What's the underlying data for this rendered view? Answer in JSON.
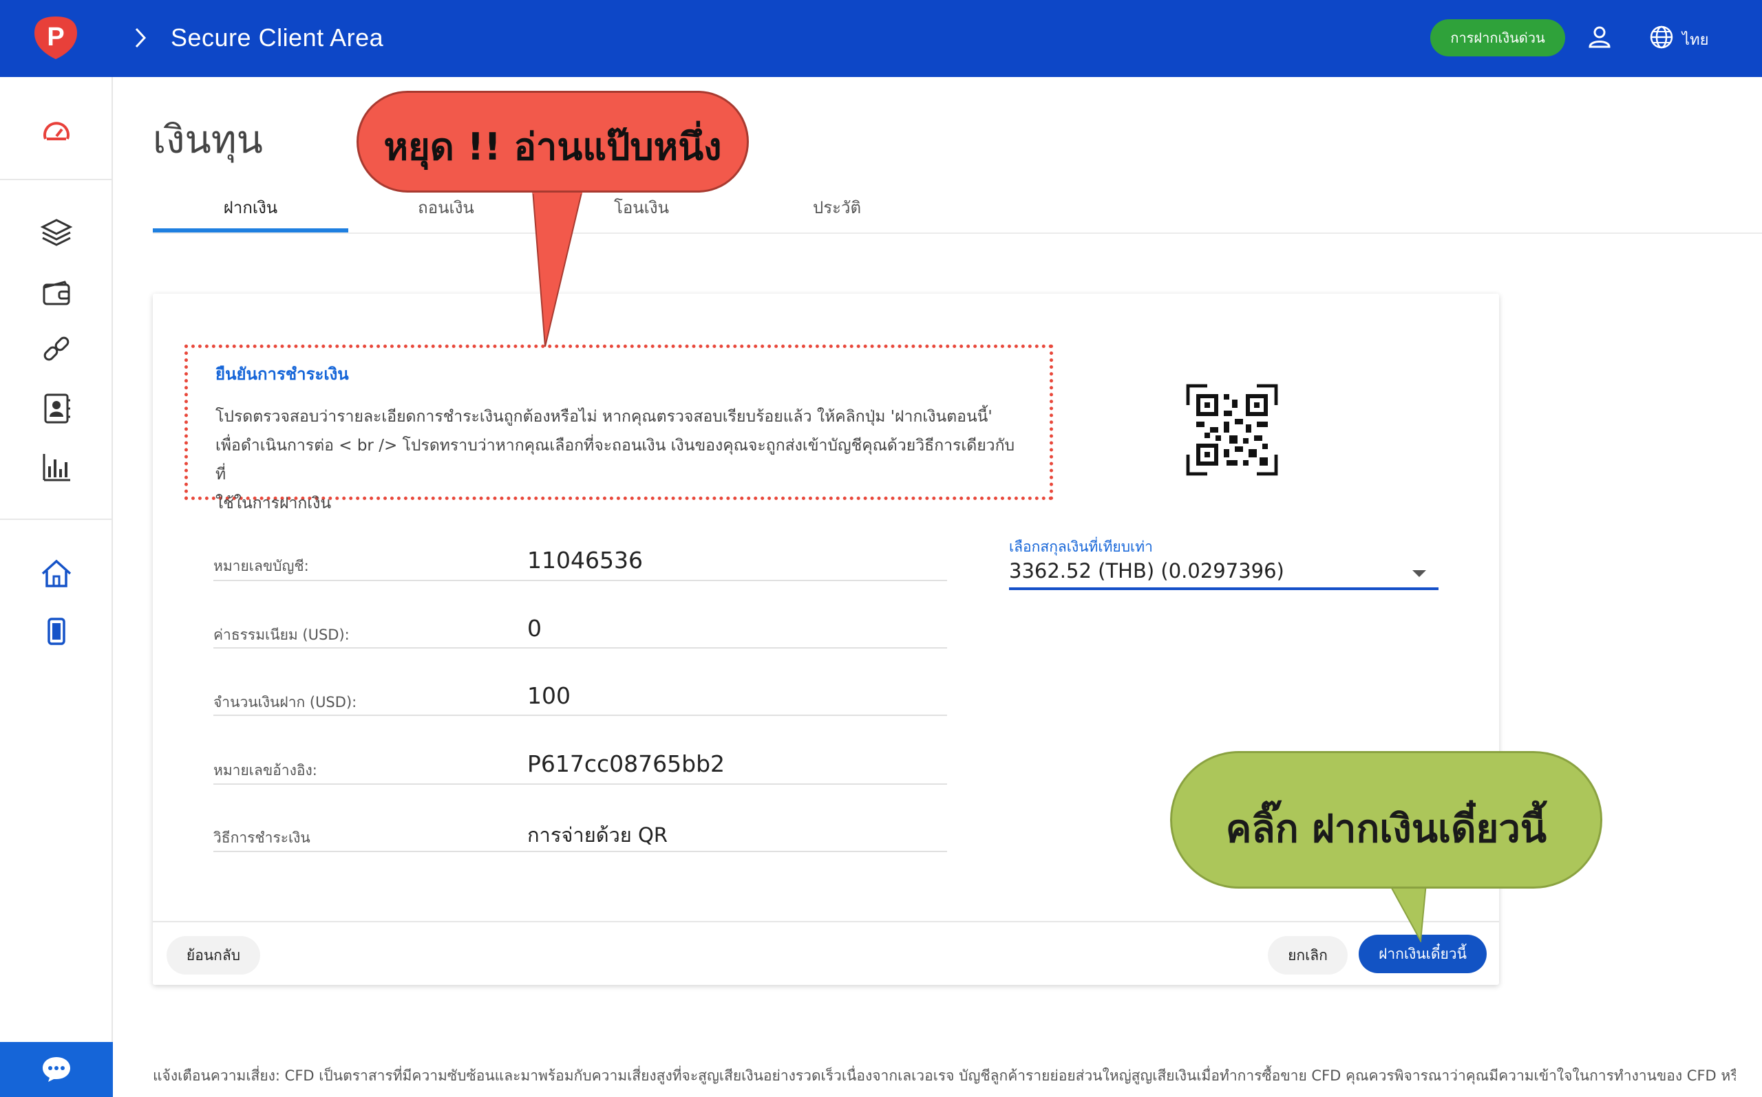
{
  "header": {
    "title": "Secure Client Area",
    "quick_deposit_label": "การฝากเงินด่วน",
    "language": "ไทย",
    "bg_color": "#0d47c7",
    "logo_letter": "P"
  },
  "sidebar": {
    "items": [
      {
        "icon": "speedometer-icon"
      },
      {
        "icon": "layers-icon"
      },
      {
        "icon": "wallet-icon"
      },
      {
        "icon": "link-icon"
      },
      {
        "icon": "contact-book-icon"
      },
      {
        "icon": "bar-chart-icon"
      },
      {
        "icon": "home-icon"
      },
      {
        "icon": "mobile-icon"
      }
    ],
    "chat_icon": "chat-bubble-icon"
  },
  "page": {
    "title": "เงินทุน",
    "tabs": [
      {
        "label": "ฝากเงิน",
        "active": true
      },
      {
        "label": "ถอนเงิน",
        "active": false
      },
      {
        "label": "โอนเงิน",
        "active": false
      },
      {
        "label": "ประวัติ",
        "active": false
      }
    ]
  },
  "confirm": {
    "title": "ยืนยันการชำระเงิน",
    "body_line1": "โปรดตรวจสอบว่ารายละเอียดการชำระเงินถูกต้องหรือไม่ หากคุณตรวจสอบเรียบร้อยแล้ว ให้คลิกปุ่ม 'ฝากเงินตอนนี้'",
    "body_line2": "เพื่อดำเนินการต่อ < br /> โปรดทราบว่าหากคุณเลือกที่จะถอนเงิน เงินของคุณจะถูกส่งเข้าบัญชีคุณด้วยวิธีการเดียวกับที่",
    "body_line3": "ใช้ในการฝากเงิน"
  },
  "details": {
    "fields": [
      {
        "label": "หมายเลขบัญชี:",
        "value": "11046536"
      },
      {
        "label": "ค่าธรรมเนียม (USD):",
        "value": "0"
      },
      {
        "label": "จำนวนเงินฝาก (USD):",
        "value": "100"
      },
      {
        "label": "หมายเลขอ้างอิง:",
        "value": "P617cc08765bb2"
      },
      {
        "label": "วิธีการชำระเงิน",
        "value": "การจ่ายด้วย QR"
      }
    ]
  },
  "currency_select": {
    "label": "เลือกสกุลเงินที่เทียบเท่า",
    "value": "3362.52 (THB) (0.0297396)"
  },
  "buttons": {
    "back": "ย้อนกลับ",
    "cancel": "ยกเลิก",
    "deposit": "ฝากเงินเดี๋ยวนี้"
  },
  "risk_warning": "แจ้งเตือนความเสี่ยง: CFD เป็นตราสารที่มีความซับซ้อนและมาพร้อมกับความเสี่ยงสูงที่จะสูญเสียเงินอย่างรวดเร็วเนื่องจากเลเวอเรจ บัญชีลูกค้ารายย่อยส่วนใหญ่สูญเสียเงินเมื่อทำการซื้อขาย CFD คุณควรพิจารณาว่าคุณมีความเข้าใจในการทำงานของ CFD หรือไม่ และคุณ",
  "callouts": {
    "stop": "หยุด !! อ่านแป๊บหนึ่ง",
    "click": "คลิ๊ก ฝากเงินเดี๋ยวนี้"
  }
}
